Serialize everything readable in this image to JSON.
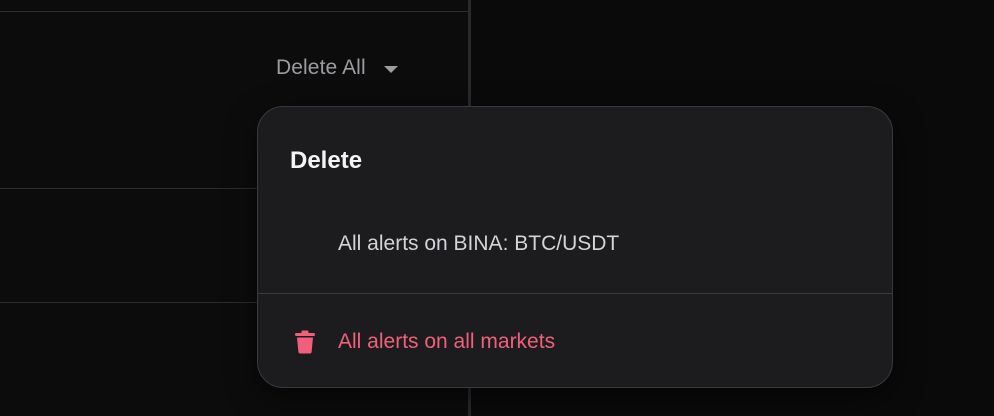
{
  "toolbar": {
    "delete_all_label": "Delete All",
    "caret_icon": "chevron-down-icon"
  },
  "dropdown": {
    "title": "Delete",
    "items": [
      {
        "label": "All alerts on BINA: BTC/USDT",
        "icon": null
      },
      {
        "label": "All alerts on all markets",
        "icon": "trash-icon",
        "color": "#f0607d"
      }
    ]
  },
  "colors": {
    "background": "#0a0a0b",
    "menu_background": "#1c1c1f",
    "danger": "#f0607d",
    "muted_text": "#9c9ca1"
  }
}
